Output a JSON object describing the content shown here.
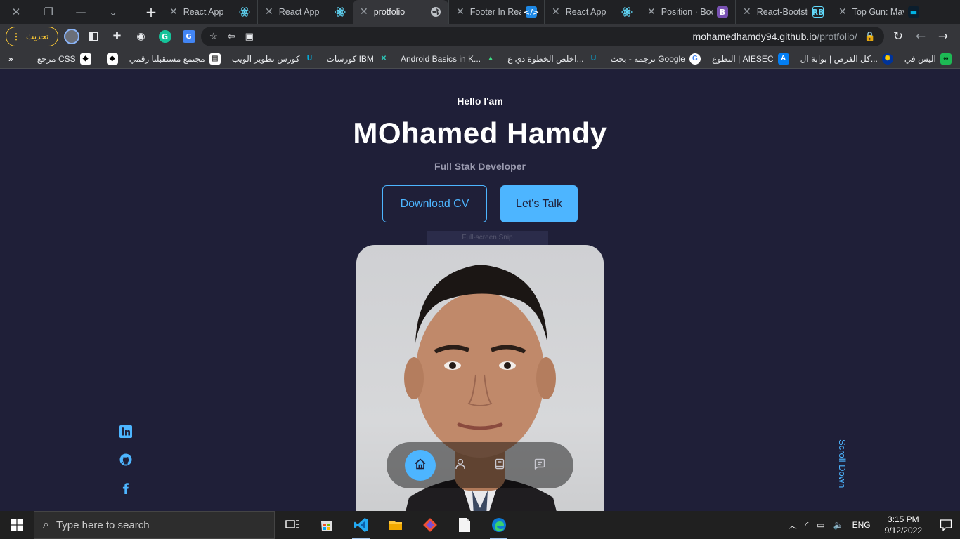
{
  "browser": {
    "tabs": [
      {
        "title": "React App",
        "favicon": "react-icon",
        "active": false
      },
      {
        "title": "React App",
        "favicon": "react-icon",
        "active": false
      },
      {
        "title": "protfolio",
        "favicon": "react-icon",
        "active": true
      },
      {
        "title": "Footer In Rea",
        "favicon": "globe-icon",
        "active": false
      },
      {
        "title": "React App",
        "favicon": "code-icon",
        "active": false
      },
      {
        "title": "Position · Boo",
        "favicon": "react-icon",
        "active": false
      },
      {
        "title": "React-Bootstr",
        "favicon": "bootstrap-icon",
        "active": false
      },
      {
        "title": "Top Gun: Mav",
        "favicon": "rb-icon",
        "active": false
      }
    ],
    "update_label": "تحديث",
    "url_host": "mohamedhamdy94.github.io",
    "url_path": "/protfolio/",
    "bookmarks": [
      {
        "label": "اليس في",
        "icon": "bookmark-icon"
      },
      {
        "label": "كل الفرص | بوابة ال...",
        "icon": "eu-icon"
      },
      {
        "label": "التطوع | AIESEC",
        "icon": "aiesec-icon"
      },
      {
        "label": "ترجمه - بحث Google",
        "icon": "google-icon"
      },
      {
        "label": "اخلص الخطوة دي ع...",
        "icon": "udacity-icon"
      },
      {
        "label": "Android Basics in K...",
        "icon": "android-icon"
      },
      {
        "label": "كورسات IBM",
        "icon": "x-icon"
      },
      {
        "label": "كورس تطوير الويب",
        "icon": "udacity-icon"
      },
      {
        "label": "مجتمع مستقبلنا رقمي",
        "icon": "doc-icon"
      },
      {
        "label": "",
        "icon": "kaggle-icon"
      },
      {
        "label": "مرجع CSS",
        "icon": "kaggle-icon"
      }
    ],
    "more_bookmarks": "»"
  },
  "hero": {
    "greeting": "Hello I'am",
    "name": "MOhamed Hamdy",
    "role": "Full Stak Developer",
    "download_cv": "Download CV",
    "lets_talk": "Let's Talk",
    "snip_overlay": "Full-screen Snip",
    "scroll_down": "Scroll Down"
  },
  "nav": {
    "items": [
      "home-icon",
      "user-icon",
      "book-icon",
      "message-icon"
    ],
    "active": "home-icon"
  },
  "socials": [
    "linkedin-icon",
    "github-icon",
    "facebook-icon"
  ],
  "taskbar": {
    "search_placeholder": "Type here to search",
    "language": "ENG",
    "time": "3:15 PM",
    "date": "9/12/2022"
  },
  "colors": {
    "page_bg": "#1f1f38",
    "accent": "#4db5ff",
    "muted_text": "#9b9bb0",
    "update_button": "#fcc934"
  }
}
